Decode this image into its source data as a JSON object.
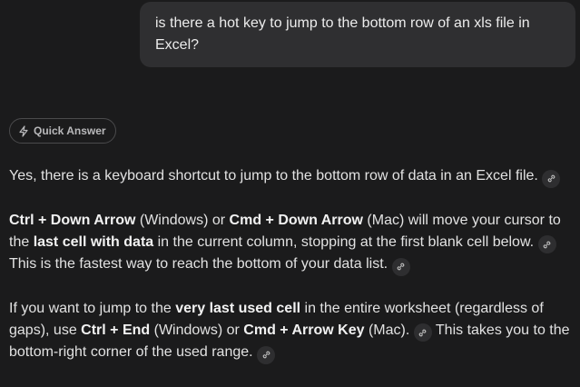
{
  "user_message": {
    "text": "is there a hot key to jump to the bottom row of an xls file in Excel?"
  },
  "quick_answer": {
    "label": "Quick Answer",
    "icon": "lightning-icon"
  },
  "answer": {
    "p1": {
      "text": "Yes, there is a keyboard shortcut to jump to the bottom row of data in an Excel file."
    },
    "p2": {
      "b1": "Ctrl + Down Arrow",
      "t1": " (Windows) or ",
      "b2": "Cmd + Down Arrow",
      "t2": " (Mac) will move your cursor to the ",
      "b3": "last cell with data",
      "t3": " in the current column, stopping at the first blank cell below.",
      "t4": " This is the fastest way to reach the bottom of your data list."
    },
    "p3": {
      "t1": "If you want to jump to the ",
      "b1": "very last used cell",
      "t2": " in the entire worksheet (regardless of gaps), use ",
      "b2": "Ctrl + End",
      "t3": " (Windows) or ",
      "b3": "Cmd + Arrow Key",
      "t4": " (Mac).",
      "t5": " This takes you to the bottom-right corner of the used range."
    }
  },
  "citation_icon": "link-icon",
  "colors": {
    "background": "#1b1b1c",
    "bubble": "#2f2f31",
    "text": "#e2e2e2",
    "muted": "#b9b9bb"
  }
}
